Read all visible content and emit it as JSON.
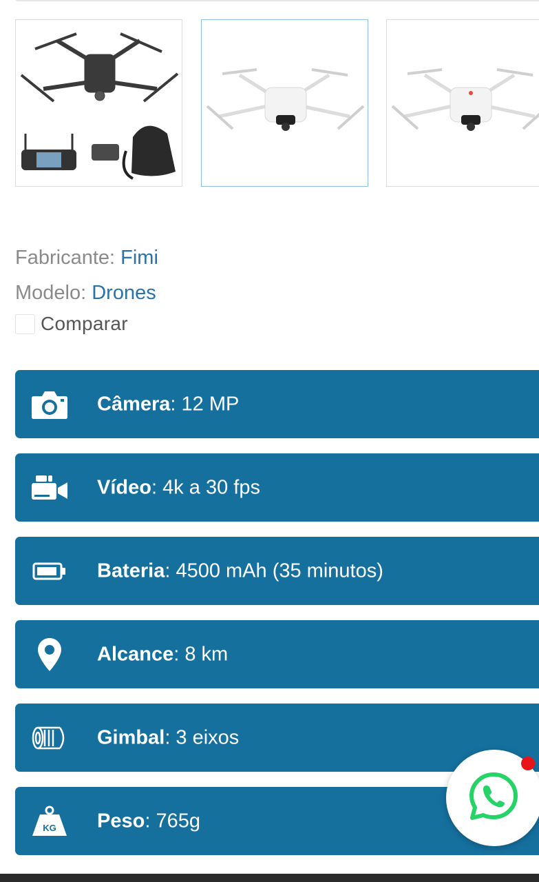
{
  "gallery": {
    "thumbnails": [
      {
        "label": "drone-kit-dark"
      },
      {
        "label": "drone-white-front"
      },
      {
        "label": "drone-white-angle"
      }
    ]
  },
  "product_meta": {
    "manufacturer_label": "Fabricante:",
    "manufacturer_value": "Fimi",
    "model_label": "Modelo:",
    "model_value": "Drones",
    "compare_label": "Comparar",
    "compare_checked": false
  },
  "specs": [
    {
      "icon": "camera-icon",
      "name": "Câmera",
      "value": ": 12 MP"
    },
    {
      "icon": "video-camera-icon",
      "name": "Vídeo",
      "value": ": 4k a 30 fps"
    },
    {
      "icon": "battery-icon",
      "name": "Bateria",
      "value": ": 4500 mAh (35 minutos)"
    },
    {
      "icon": "location-pin-icon",
      "name": "Alcance",
      "value": ": 8 km"
    },
    {
      "icon": "gimbal-icon",
      "name": "Gimbal",
      "value": ": 3 eixos"
    },
    {
      "icon": "weight-icon",
      "name": "Peso",
      "value": ": 765g",
      "icon_text": "KG"
    }
  ],
  "colors": {
    "spec_background": "#15709e",
    "link": "#2a73a8",
    "whatsapp_green": "#25d366",
    "notification_dot": "#e8141a"
  },
  "whatsapp": {
    "icon": "whatsapp-icon",
    "has_notification": true
  }
}
